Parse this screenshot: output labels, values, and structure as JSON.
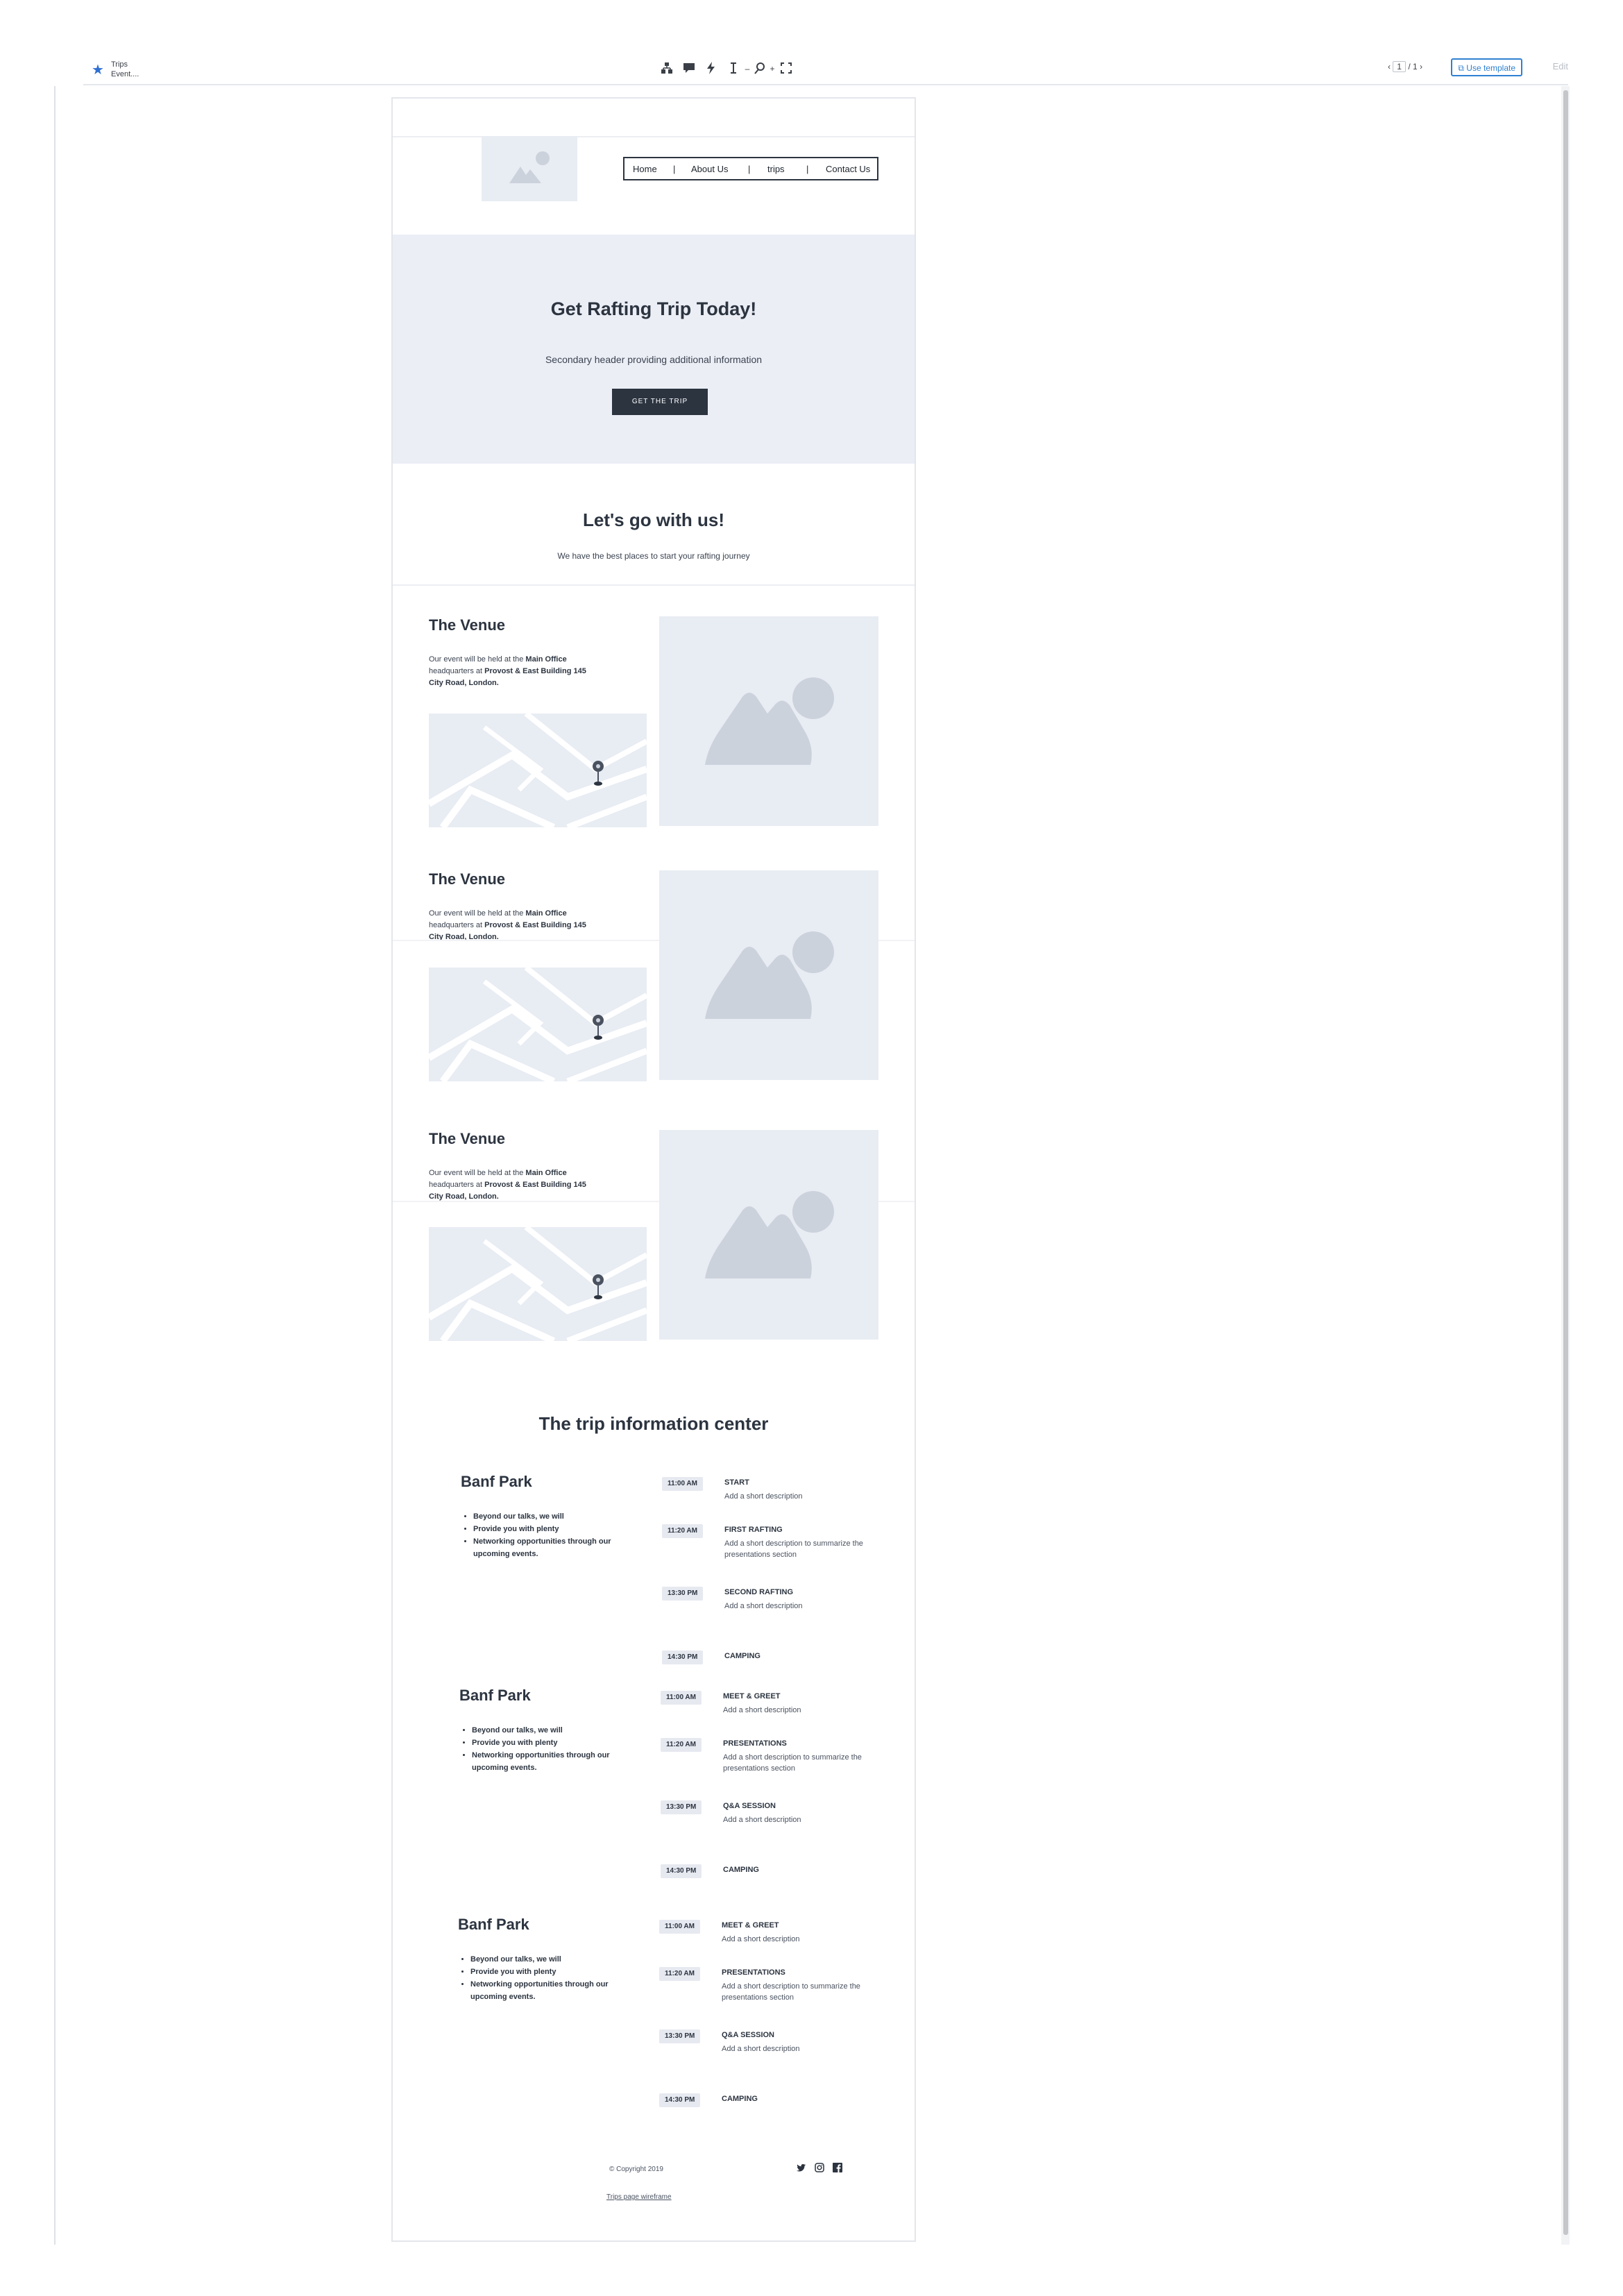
{
  "toolbar": {
    "file_title_line1": "Trips",
    "file_title_line2": "Event....",
    "page_current": "1",
    "page_total": "/ 1",
    "use_template_label": "Use template",
    "edit_label": "Edit"
  },
  "nav": {
    "items": [
      "Home",
      "About Us",
      "trips",
      "Contact Us"
    ],
    "separators": [
      "|",
      "|",
      "|"
    ]
  },
  "hero": {
    "title": "Get Rafting Trip Today!",
    "subtitle": "Secondary header providing additional information",
    "button_label": "GET THE TRIP"
  },
  "intro": {
    "title": "Let's go with us!",
    "subtitle": "We have the best places to start your rafting journey"
  },
  "venues": [
    {
      "title": "The Venue",
      "text_1": "Our event will be held at the ",
      "bold_1": "Main Office",
      "text_2": " headquarters at ",
      "bold_2": "Provost & East Building 145 City Road, London."
    },
    {
      "title": "The Venue",
      "text_1": "Our event will be held at the ",
      "bold_1": "Main Office",
      "text_2": " headquarters at ",
      "bold_2": "Provost & East Building 145 City Road, London."
    },
    {
      "title": "The Venue",
      "text_1": "Our event will be held at the ",
      "bold_1": "Main Office",
      "text_2": " headquarters at ",
      "bold_2": "Provost & East Building 145 City Road, London."
    }
  ],
  "info_center": {
    "title": "The trip information center",
    "parks": [
      {
        "name": "Banf Park",
        "bullets": [
          "Beyond our talks, we will",
          "Provide you with plenty",
          "Networking opportunities through our upcoming events."
        ],
        "schedule": [
          {
            "time": "11:00 AM",
            "title": "START",
            "desc": "Add a short description"
          },
          {
            "time": "11:20 AM",
            "title": "FIRST RAFTING",
            "desc": "Add a short description to summarize the presentations section"
          },
          {
            "time": "13:30 PM",
            "title": "SECOND RAFTING",
            "desc": "Add a short description"
          },
          {
            "time": "14:30 PM",
            "title": "CAMPING",
            "desc": ""
          }
        ]
      },
      {
        "name": "Banf Park",
        "bullets": [
          "Beyond our talks, we will",
          "Provide you with plenty",
          "Networking opportunities through our upcoming events."
        ],
        "schedule": [
          {
            "time": "11:00 AM",
            "title": "MEET & GREET",
            "desc": "Add a short description"
          },
          {
            "time": "11:20 AM",
            "title": "PRESENTATIONS",
            "desc": "Add a short description to summarize the presentations section"
          },
          {
            "time": "13:30 PM",
            "title": "Q&A SESSION",
            "desc": "Add a short description"
          },
          {
            "time": "14:30 PM",
            "title": "CAMPING",
            "desc": ""
          }
        ]
      },
      {
        "name": "Banf Park",
        "bullets": [
          "Beyond our talks, we will",
          "Provide you with plenty",
          "Networking opportunities through our upcoming events."
        ],
        "schedule": [
          {
            "time": "11:00 AM",
            "title": "MEET & GREET",
            "desc": "Add a short description"
          },
          {
            "time": "11:20 AM",
            "title": "PRESENTATIONS",
            "desc": "Add a short description to summarize the presentations section"
          },
          {
            "time": "13:30 PM",
            "title": "Q&A SESSION",
            "desc": "Add a short description"
          },
          {
            "time": "14:30 PM",
            "title": "CAMPING",
            "desc": ""
          }
        ]
      }
    ]
  },
  "footer": {
    "copyright": "© Copyright 2019",
    "wireframe_link": "Trips page wireframe",
    "social_icons": [
      "twitter-icon",
      "instagram-icon",
      "facebook-icon"
    ]
  },
  "colors": {
    "accent_blue": "#2f80d0",
    "dark": "#2c3440",
    "placeholder": "#e8ecf3",
    "placeholder_shape": "#ccd2dc"
  }
}
